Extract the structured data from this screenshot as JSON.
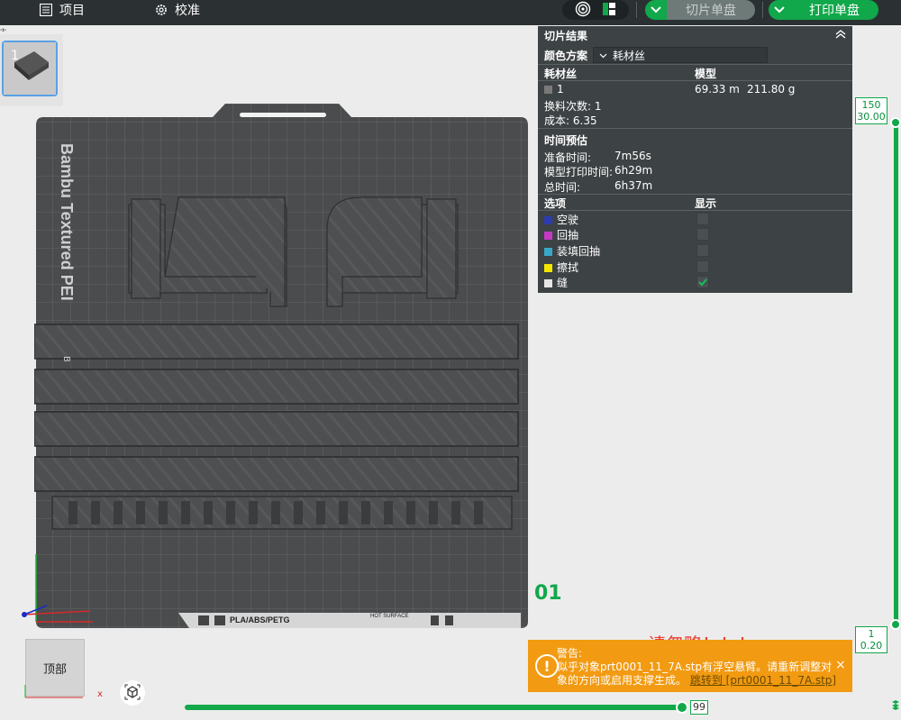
{
  "topbar": {
    "project_label": "项目",
    "calibrate_label": "校准",
    "slice_label": "切片单盘",
    "print_label": "打印单盘"
  },
  "thumbnail": {
    "index": "1",
    "mark": "◃▹"
  },
  "plate": {
    "brand_text": "Bambu Textured PEI",
    "side_mark": "B",
    "footer_materials": "PLA/ABS/PETG",
    "hot_surface": "HOT SURFACE",
    "plate_number": "01"
  },
  "slice_result": {
    "title": "切片结果",
    "color_scheme_label": "颜色方案",
    "color_scheme_value": "耗材丝",
    "filament_header": "耗材丝",
    "model_header": "模型",
    "filament_index": "1",
    "length": "69.33 m",
    "weight": "211.80 g",
    "changes_label": "换料次数:",
    "changes_value": "1",
    "cost_label": "成本:",
    "cost_value": "6.35",
    "time_title": "时间预估",
    "prep_label": "准备时间:",
    "prep_value": "7m56s",
    "model_time_label": "模型打印时间:",
    "model_time_value": "6h29m",
    "total_label": "总时间:",
    "total_value": "6h37m",
    "options_header": "选项",
    "display_header": "显示",
    "options": [
      {
        "label": "空驶",
        "color": "#2d3bb0",
        "checked": false
      },
      {
        "label": "回抽",
        "color": "#c43ac4",
        "checked": false
      },
      {
        "label": "装填回抽",
        "color": "#38a8c8",
        "checked": false
      },
      {
        "label": "擦拭",
        "color": "#f2e600",
        "checked": false
      },
      {
        "label": "缝",
        "color": "#e6e6e6",
        "checked": true
      }
    ]
  },
  "layer_slider": {
    "top_layer": "150",
    "top_height": "30.00",
    "bottom_layer": "1",
    "bottom_height": "0.20"
  },
  "move_slider": {
    "value": "99"
  },
  "warning": {
    "title": "警告:",
    "message_1": "似乎对象prt0001_11_7A.stp有浮空悬臂。请重新调整对",
    "message_2": "象的方向或启用支撑生成。",
    "link": "跳转到 [prt0001_11_7A.stp]",
    "close": "×"
  },
  "ignore_note": "请忽略！！！",
  "view_cube": {
    "label": "顶部"
  },
  "axes": {
    "x": "x"
  },
  "colors": {
    "accent": "#10a84a",
    "warning": "#f29a11",
    "topbar": "#2b3133",
    "panel": "#3d4244"
  }
}
